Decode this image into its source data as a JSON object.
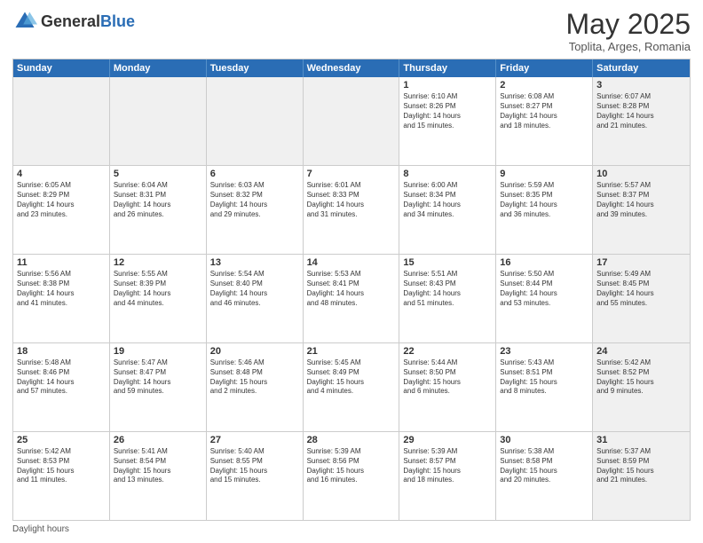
{
  "header": {
    "logo_general": "General",
    "logo_blue": "Blue",
    "month_title": "May 2025",
    "location": "Toplita, Arges, Romania"
  },
  "days_of_week": [
    "Sunday",
    "Monday",
    "Tuesday",
    "Wednesday",
    "Thursday",
    "Friday",
    "Saturday"
  ],
  "footer": {
    "daylight_label": "Daylight hours"
  },
  "weeks": [
    {
      "cells": [
        {
          "day": "",
          "text": "",
          "shaded": true
        },
        {
          "day": "",
          "text": "",
          "shaded": true
        },
        {
          "day": "",
          "text": "",
          "shaded": true
        },
        {
          "day": "",
          "text": "",
          "shaded": true
        },
        {
          "day": "1",
          "text": "Sunrise: 6:10 AM\nSunset: 8:26 PM\nDaylight: 14 hours\nand 15 minutes."
        },
        {
          "day": "2",
          "text": "Sunrise: 6:08 AM\nSunset: 8:27 PM\nDaylight: 14 hours\nand 18 minutes."
        },
        {
          "day": "3",
          "text": "Sunrise: 6:07 AM\nSunset: 8:28 PM\nDaylight: 14 hours\nand 21 minutes.",
          "shaded": true
        }
      ]
    },
    {
      "cells": [
        {
          "day": "4",
          "text": "Sunrise: 6:05 AM\nSunset: 8:29 PM\nDaylight: 14 hours\nand 23 minutes."
        },
        {
          "day": "5",
          "text": "Sunrise: 6:04 AM\nSunset: 8:31 PM\nDaylight: 14 hours\nand 26 minutes."
        },
        {
          "day": "6",
          "text": "Sunrise: 6:03 AM\nSunset: 8:32 PM\nDaylight: 14 hours\nand 29 minutes."
        },
        {
          "day": "7",
          "text": "Sunrise: 6:01 AM\nSunset: 8:33 PM\nDaylight: 14 hours\nand 31 minutes."
        },
        {
          "day": "8",
          "text": "Sunrise: 6:00 AM\nSunset: 8:34 PM\nDaylight: 14 hours\nand 34 minutes."
        },
        {
          "day": "9",
          "text": "Sunrise: 5:59 AM\nSunset: 8:35 PM\nDaylight: 14 hours\nand 36 minutes."
        },
        {
          "day": "10",
          "text": "Sunrise: 5:57 AM\nSunset: 8:37 PM\nDaylight: 14 hours\nand 39 minutes.",
          "shaded": true
        }
      ]
    },
    {
      "cells": [
        {
          "day": "11",
          "text": "Sunrise: 5:56 AM\nSunset: 8:38 PM\nDaylight: 14 hours\nand 41 minutes."
        },
        {
          "day": "12",
          "text": "Sunrise: 5:55 AM\nSunset: 8:39 PM\nDaylight: 14 hours\nand 44 minutes."
        },
        {
          "day": "13",
          "text": "Sunrise: 5:54 AM\nSunset: 8:40 PM\nDaylight: 14 hours\nand 46 minutes."
        },
        {
          "day": "14",
          "text": "Sunrise: 5:53 AM\nSunset: 8:41 PM\nDaylight: 14 hours\nand 48 minutes."
        },
        {
          "day": "15",
          "text": "Sunrise: 5:51 AM\nSunset: 8:43 PM\nDaylight: 14 hours\nand 51 minutes."
        },
        {
          "day": "16",
          "text": "Sunrise: 5:50 AM\nSunset: 8:44 PM\nDaylight: 14 hours\nand 53 minutes."
        },
        {
          "day": "17",
          "text": "Sunrise: 5:49 AM\nSunset: 8:45 PM\nDaylight: 14 hours\nand 55 minutes.",
          "shaded": true
        }
      ]
    },
    {
      "cells": [
        {
          "day": "18",
          "text": "Sunrise: 5:48 AM\nSunset: 8:46 PM\nDaylight: 14 hours\nand 57 minutes."
        },
        {
          "day": "19",
          "text": "Sunrise: 5:47 AM\nSunset: 8:47 PM\nDaylight: 14 hours\nand 59 minutes."
        },
        {
          "day": "20",
          "text": "Sunrise: 5:46 AM\nSunset: 8:48 PM\nDaylight: 15 hours\nand 2 minutes."
        },
        {
          "day": "21",
          "text": "Sunrise: 5:45 AM\nSunset: 8:49 PM\nDaylight: 15 hours\nand 4 minutes."
        },
        {
          "day": "22",
          "text": "Sunrise: 5:44 AM\nSunset: 8:50 PM\nDaylight: 15 hours\nand 6 minutes."
        },
        {
          "day": "23",
          "text": "Sunrise: 5:43 AM\nSunset: 8:51 PM\nDaylight: 15 hours\nand 8 minutes."
        },
        {
          "day": "24",
          "text": "Sunrise: 5:42 AM\nSunset: 8:52 PM\nDaylight: 15 hours\nand 9 minutes.",
          "shaded": true
        }
      ]
    },
    {
      "cells": [
        {
          "day": "25",
          "text": "Sunrise: 5:42 AM\nSunset: 8:53 PM\nDaylight: 15 hours\nand 11 minutes."
        },
        {
          "day": "26",
          "text": "Sunrise: 5:41 AM\nSunset: 8:54 PM\nDaylight: 15 hours\nand 13 minutes."
        },
        {
          "day": "27",
          "text": "Sunrise: 5:40 AM\nSunset: 8:55 PM\nDaylight: 15 hours\nand 15 minutes."
        },
        {
          "day": "28",
          "text": "Sunrise: 5:39 AM\nSunset: 8:56 PM\nDaylight: 15 hours\nand 16 minutes."
        },
        {
          "day": "29",
          "text": "Sunrise: 5:39 AM\nSunset: 8:57 PM\nDaylight: 15 hours\nand 18 minutes."
        },
        {
          "day": "30",
          "text": "Sunrise: 5:38 AM\nSunset: 8:58 PM\nDaylight: 15 hours\nand 20 minutes."
        },
        {
          "day": "31",
          "text": "Sunrise: 5:37 AM\nSunset: 8:59 PM\nDaylight: 15 hours\nand 21 minutes.",
          "shaded": true
        }
      ]
    }
  ]
}
